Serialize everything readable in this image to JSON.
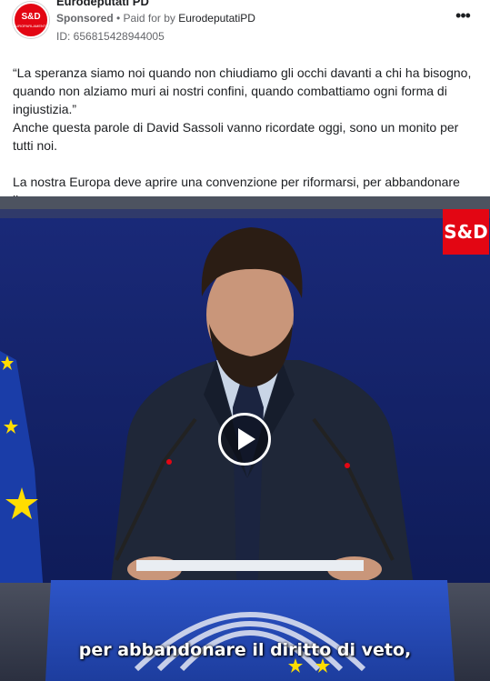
{
  "post": {
    "page_name": "Eurodeputati PD",
    "avatar": {
      "text": "S&D",
      "subtext": "EUROPARLAMENTO",
      "color": "#e30613"
    },
    "sponsored_label": "Sponsored",
    "separator": " • ",
    "paid_for_prefix": "Paid for by ",
    "paid_for_name": "EurodeputatiPD",
    "ad_id": "ID: 656815428944005",
    "more_icon": "more-horizontal-icon",
    "more_label": "•••",
    "text": {
      "line1": "“La speranza siamo noi quando non chiudiamo gli occhi davanti a chi ha bisogno, quando non alziamo muri ai nostri confini, quando combattiamo ogni forma di ingiustizia.”",
      "line2": "Anche questa parole di David Sassoli vanno ricordate oggi, sono un monito per tutti noi.",
      "line3": "La nostra Europa deve aprire una convenzione per riformarsi, per abbandonare il..."
    }
  },
  "video": {
    "logo_text": "S&D",
    "subtitle": "per abbandonare il diritto di veto,",
    "play_icon": "play-icon",
    "colors": {
      "background": "#0e1a55",
      "logo": "#e30613",
      "eu_flag": "#1a3da8",
      "star": "#ffdd00"
    }
  }
}
